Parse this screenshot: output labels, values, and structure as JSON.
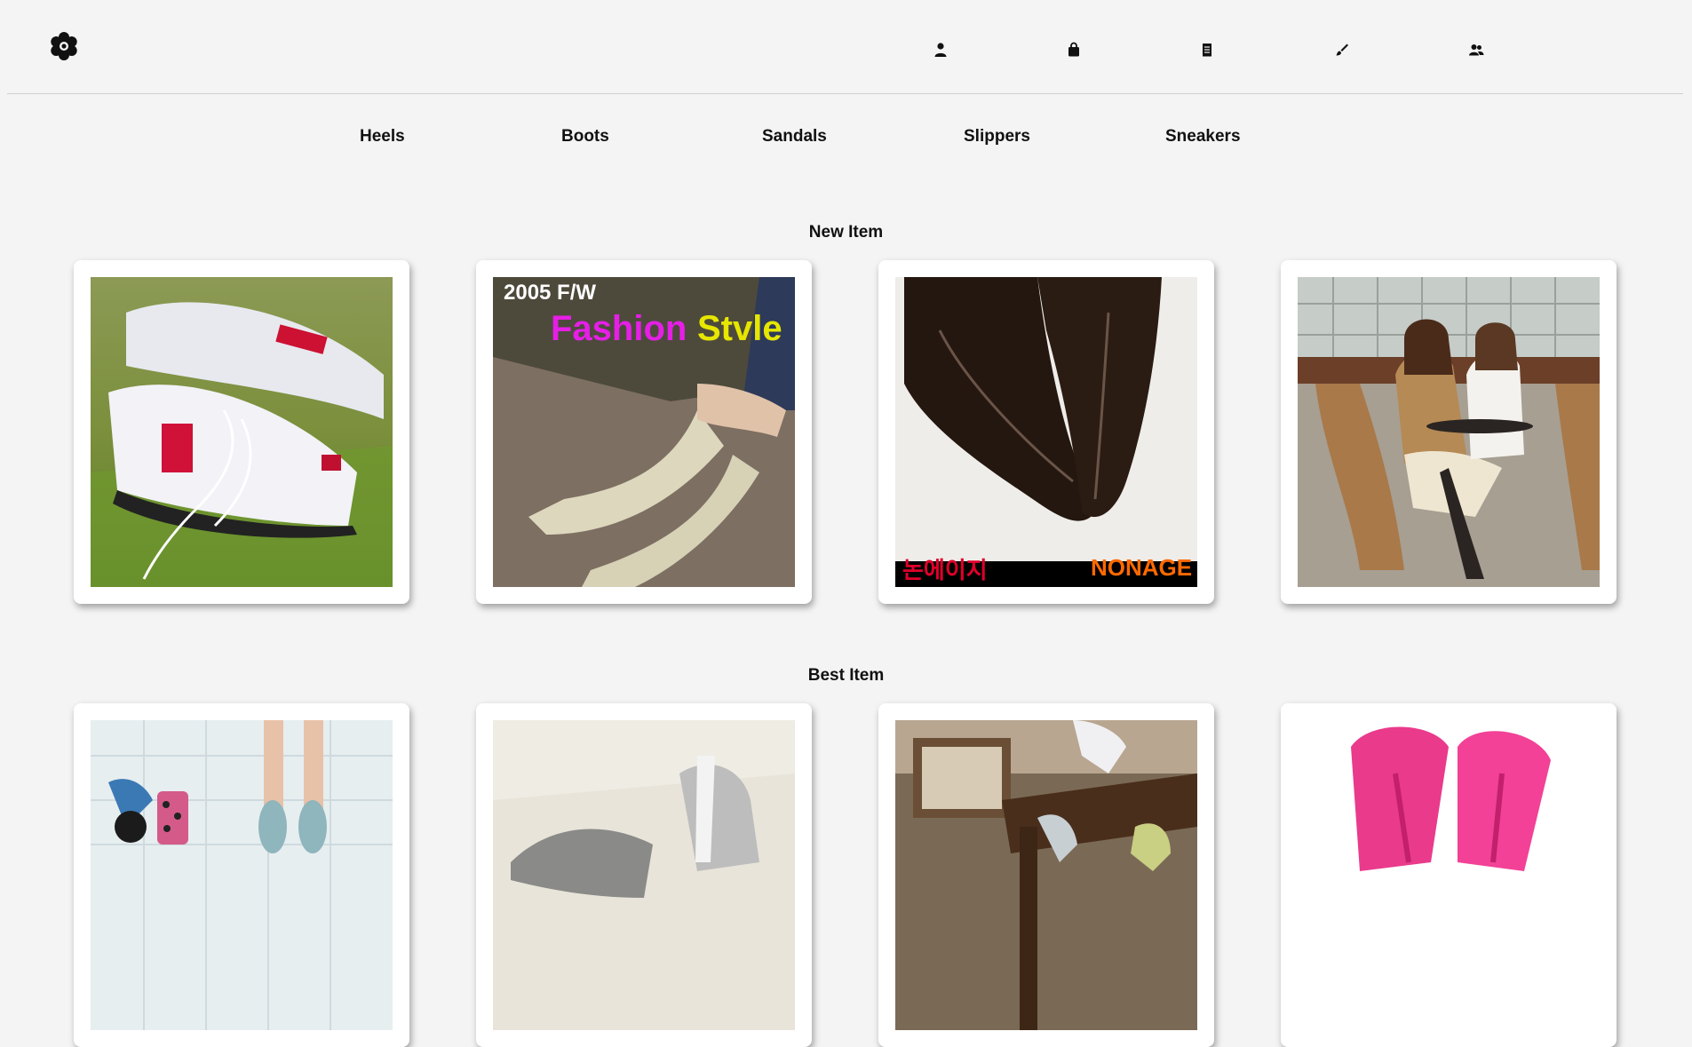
{
  "header": {
    "logo_icon": "flower-gear-icon",
    "nav_icons": [
      "user-icon",
      "shopping-bag-icon",
      "receipt-icon",
      "brush-icon",
      "users-icon"
    ]
  },
  "categories": [
    "Heels",
    "Boots",
    "Sandals",
    "Slippers",
    "Sneakers"
  ],
  "sections": {
    "new": {
      "title": "New Item"
    },
    "best": {
      "title": "Best Item"
    }
  },
  "new_items": [
    {
      "image": "white sneakers on grass",
      "overlay": []
    },
    {
      "image": "knit boots on rock",
      "overlay": [
        "2005 F/W",
        "Fashion",
        "Stvle"
      ]
    },
    {
      "image": "black leather pointed boots",
      "overlay": [
        "논에이지",
        "NONAGE"
      ]
    },
    {
      "image": "two women at cafe table",
      "overlay": []
    }
  ],
  "best_items": [
    {
      "image": "sandals on tile floor"
    },
    {
      "image": "silver heels blurred"
    },
    {
      "image": "shoes on wooden chair"
    },
    {
      "image": "pink flip flops"
    }
  ],
  "colors": {
    "background": "#f4f4f4",
    "card": "#ffffff",
    "accent_magenta": "#e61ee6",
    "accent_yellow": "#e6e600",
    "accent_orange": "#ff6a00",
    "accent_red": "#e0002a"
  }
}
